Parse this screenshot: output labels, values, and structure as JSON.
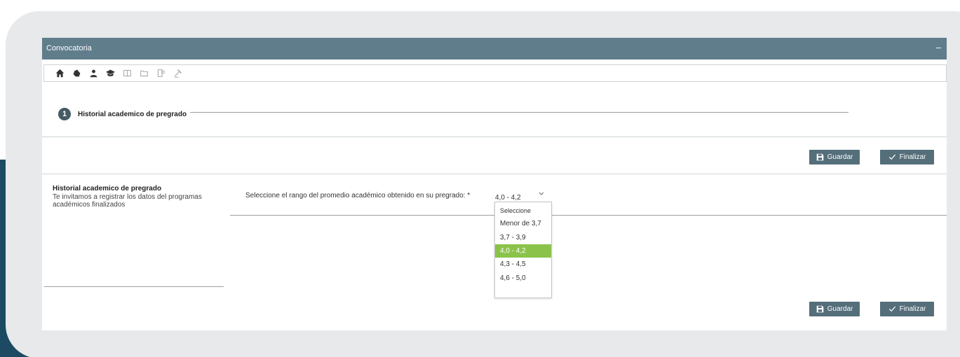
{
  "window": {
    "title": "Convocatoria",
    "minimize": "–"
  },
  "toolbar": {
    "icons": [
      "home-icon",
      "puzzle-icon",
      "user-icon",
      "graduation-cap-icon",
      "book-icon",
      "folder-icon",
      "certificate-icon",
      "gavel-icon"
    ]
  },
  "step": {
    "number": "1",
    "label": "Historial academico de pregrado"
  },
  "buttons": {
    "save_label": "Guardar",
    "finish_label": "Finalizar"
  },
  "section": {
    "title": "Historial academico de pregrado",
    "description": "Te invitamos a registrar los datos del programas académicos finalizados"
  },
  "field": {
    "label": "Seleccione el rango del promedio académico obtenido en su pregrado: *",
    "value": "4,0 - 4,2",
    "options": [
      "Seleccione",
      "Menor de 3,7",
      "3,7 - 3,9",
      "4,0 - 4,2",
      "4,3 - 4,5",
      "4,6 - 5,0"
    ],
    "selected_index": 3
  },
  "colors": {
    "titlebar": "#607d8b",
    "button": "#546e7a",
    "selected": "#8bc34a",
    "navy": "#1c4a63"
  }
}
